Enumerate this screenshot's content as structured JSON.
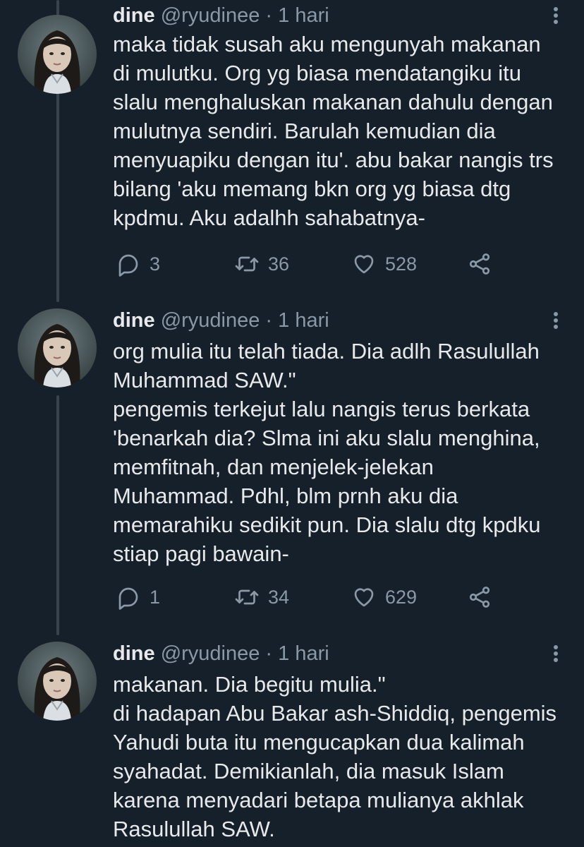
{
  "tweets": [
    {
      "name": "dine",
      "meta": "@ryudinee · 1 hari",
      "lines": [
        "maka tidak susah aku mengunyah makanan",
        "di mulutku. Org yg biasa mendatangiku itu",
        "slalu menghaluskan makanan dahulu dengan",
        "mulutnya sendiri. Barulah kemudian dia",
        "menyuapiku dengan itu'. abu bakar nangis trs",
        "bilang 'aku memang bkn org yg biasa dtg",
        "kpdmu. Aku adalhh sahabatnya-"
      ],
      "replies": "3",
      "retweets": "36",
      "likes": "528"
    },
    {
      "name": "dine",
      "meta": "@ryudinee · 1 hari",
      "lines": [
        "org mulia itu telah tiada. Dia adlh Rasulullah",
        "Muhammad SAW.\"",
        "pengemis terkejut lalu nangis terus berkata",
        "'benarkah dia? Slma ini aku slalu menghina,",
        "memfitnah, dan menjelek-jelekan",
        "Muhammad. Pdhl, blm prnh aku dia",
        "memarahiku sedikit pun. Dia slalu dtg kpdku",
        "stiap pagi bawain-"
      ],
      "replies": "1",
      "retweets": "34",
      "likes": "629"
    },
    {
      "name": "dine",
      "meta": "@ryudinee · 1 hari",
      "lines": [
        "makanan. Dia begitu mulia.\"",
        "di hadapan Abu Bakar ash-Shiddiq, pengemis",
        "Yahudi buta itu mengucapkan dua kalimah",
        "syahadat. Demikianlah, dia masuk Islam",
        "karena menyadari betapa mulianya akhlak",
        "Rasulullah SAW."
      ]
    }
  ],
  "colors": {
    "background": "#15202b",
    "text": "#e7e9ea",
    "secondary": "#8b98a5",
    "thread_line": "#38444d"
  },
  "icons": {
    "more": "more-vertical-icon",
    "reply": "reply-icon",
    "retweet": "retweet-icon",
    "like": "heart-icon",
    "share": "share-icon"
  }
}
